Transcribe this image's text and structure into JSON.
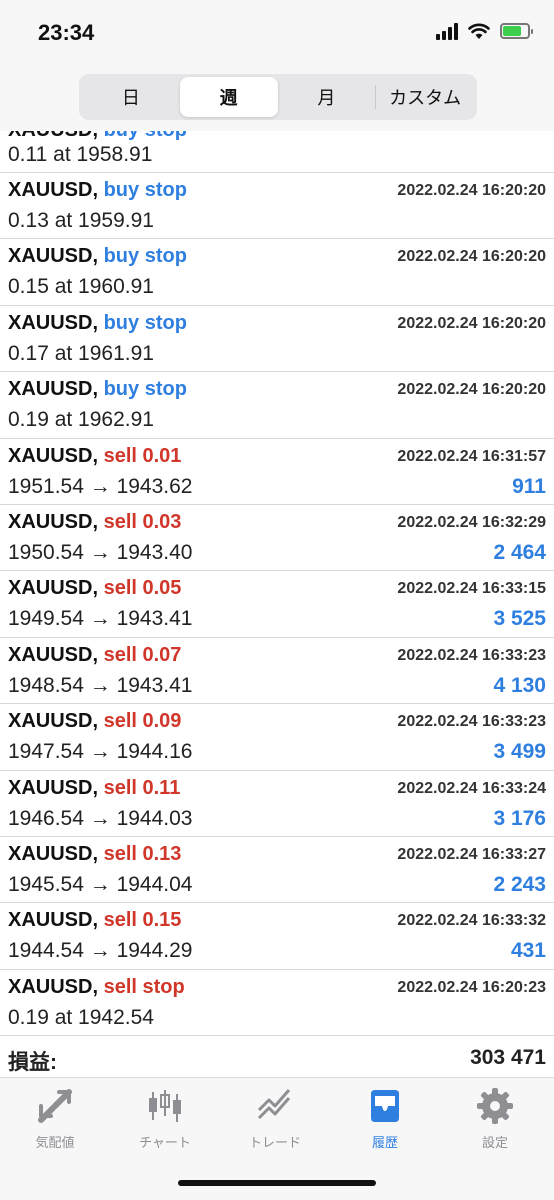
{
  "status_bar": {
    "time": "23:34"
  },
  "period_tabs": [
    {
      "label": "日",
      "active": false
    },
    {
      "label": "週",
      "active": true
    },
    {
      "label": "月",
      "active": false
    },
    {
      "label": "カスタム",
      "active": false
    }
  ],
  "partial_row": {
    "symbol": "XAUUSD,",
    "action": "buy stop",
    "detail": "0.11 at 1958.91"
  },
  "trades": [
    {
      "symbol": "XAUUSD,",
      "action": "buy stop",
      "side": "buy",
      "time": "2022.02.24 16:20:20",
      "detail": "0.13 at 1959.91",
      "profit": ""
    },
    {
      "symbol": "XAUUSD,",
      "action": "buy stop",
      "side": "buy",
      "time": "2022.02.24 16:20:20",
      "detail": "0.15 at 1960.91",
      "profit": ""
    },
    {
      "symbol": "XAUUSD,",
      "action": "buy stop",
      "side": "buy",
      "time": "2022.02.24 16:20:20",
      "detail": "0.17 at 1961.91",
      "profit": ""
    },
    {
      "symbol": "XAUUSD,",
      "action": "buy stop",
      "side": "buy",
      "time": "2022.02.24 16:20:20",
      "detail": "0.19 at 1962.91",
      "profit": ""
    },
    {
      "symbol": "XAUUSD,",
      "action": "sell 0.01",
      "side": "sell",
      "time": "2022.02.24 16:31:57",
      "detail": "1951.54 → 1943.62",
      "profit": "911"
    },
    {
      "symbol": "XAUUSD,",
      "action": "sell 0.03",
      "side": "sell",
      "time": "2022.02.24 16:32:29",
      "detail": "1950.54 → 1943.40",
      "profit": "2 464"
    },
    {
      "symbol": "XAUUSD,",
      "action": "sell 0.05",
      "side": "sell",
      "time": "2022.02.24 16:33:15",
      "detail": "1949.54 → 1943.41",
      "profit": "3 525"
    },
    {
      "symbol": "XAUUSD,",
      "action": "sell 0.07",
      "side": "sell",
      "time": "2022.02.24 16:33:23",
      "detail": "1948.54 → 1943.41",
      "profit": "4 130"
    },
    {
      "symbol": "XAUUSD,",
      "action": "sell 0.09",
      "side": "sell",
      "time": "2022.02.24 16:33:23",
      "detail": "1947.54 → 1944.16",
      "profit": "3 499"
    },
    {
      "symbol": "XAUUSD,",
      "action": "sell 0.11",
      "side": "sell",
      "time": "2022.02.24 16:33:24",
      "detail": "1946.54 → 1944.03",
      "profit": "3 176"
    },
    {
      "symbol": "XAUUSD,",
      "action": "sell 0.13",
      "side": "sell",
      "time": "2022.02.24 16:33:27",
      "detail": "1945.54 → 1944.04",
      "profit": "2 243"
    },
    {
      "symbol": "XAUUSD,",
      "action": "sell 0.15",
      "side": "sell",
      "time": "2022.02.24 16:33:32",
      "detail": "1944.54 → 1944.29",
      "profit": "431"
    },
    {
      "symbol": "XAUUSD,",
      "action": "sell stop",
      "side": "sell",
      "time": "2022.02.24 16:20:23",
      "detail": "0.19 at 1942.54",
      "profit": ""
    }
  ],
  "total": {
    "label": "損益:",
    "value": "303 471"
  },
  "tabbar": [
    {
      "label": "気配値",
      "icon": "quotes-icon",
      "active": false
    },
    {
      "label": "チャート",
      "icon": "chart-icon",
      "active": false
    },
    {
      "label": "トレード",
      "icon": "trade-icon",
      "active": false
    },
    {
      "label": "履歴",
      "icon": "history-icon",
      "active": true
    },
    {
      "label": "設定",
      "icon": "settings-icon",
      "active": false
    }
  ],
  "colors": {
    "buy": "#2f7fe0",
    "sell": "#d0362a",
    "accent": "#2f7fe0"
  }
}
